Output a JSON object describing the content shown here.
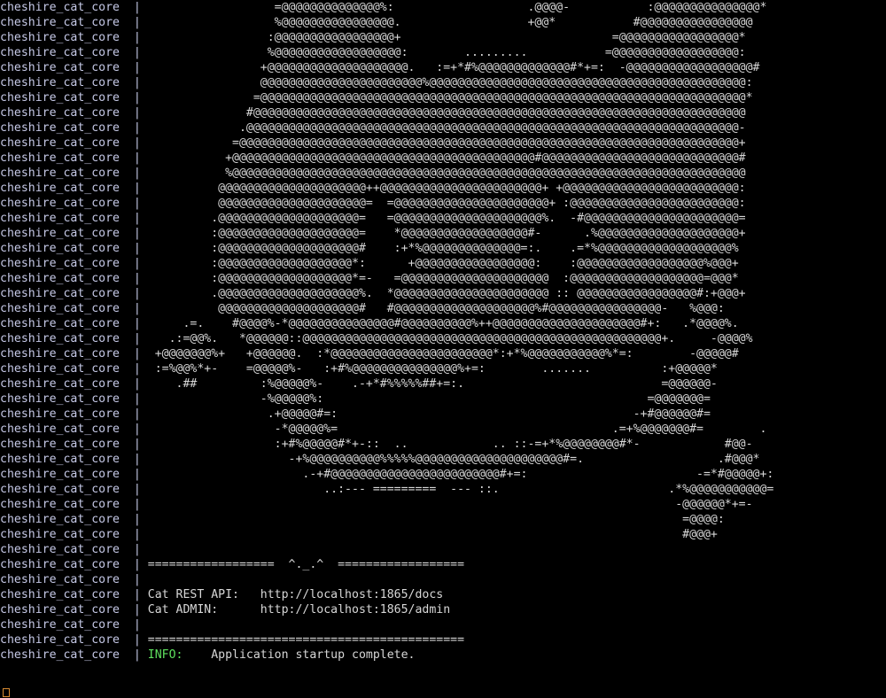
{
  "terminal": {
    "service_name": "cheshire_cat_core",
    "separator": "|",
    "background_color": "#000000",
    "service_color": "#c5c8e6",
    "art_color": "#d7d7d7",
    "info_color": "#5ee05e",
    "cursor_color": "#d98b32"
  },
  "banner": {
    "divider_top": "==================  ^._.^  ==================",
    "cat_face": "^._.^",
    "divider_bottom": "=============================================",
    "rest_api_label": "Cat REST API:",
    "rest_api_url": "http://localhost:1865/docs",
    "admin_label": "Cat ADMIN:",
    "admin_url": "http://localhost:1865/admin",
    "log_level": "INFO:",
    "status_message": "Application startup complete."
  },
  "ascii_art": {
    "description": "cheshire cat face rendered in ascii density characters",
    "charset": "@%#*+=:-. ",
    "lines": [
      "                   =@@@@@@@@@@@@@@%:                   .@@@@-           :@@@@@@@@@@@@@@@*",
      "                   %@@@@@@@@@@@@@@@@.                  +@@*           #@@@@@@@@@@@@@@@@",
      "                  :@@@@@@@@@@@@@@@@@+                              =@@@@@@@@@@@@@@@@@*",
      "                  %@@@@@@@@@@@@@@@@@@:        .........           =@@@@@@@@@@@@@@@@@@:",
      "                 +@@@@@@@@@@@@@@@@@@@@.   :=+*#%@@@@@@@@@@@@@#*+=:  -@@@@@@@@@@@@@@@@@@#",
      "                 @@@@@@@@@@@@@@@@@@@@@@@%@@@@@@@@@@@@@@@@@@@@@@@@@@@@@@@@@@@@@@@@@@@@@:",
      "                =@@@@@@@@@@@@@@@@@@@@@@@@@@@@@@@@@@@@@@@@@@@@@@@@@@@@@@@@@@@@@@@@@@@@@*",
      "               #@@@@@@@@@@@@@@@@@@@@@@@@@@@@@@@@@@@@@@@@@@@@@@@@@@@@@@@@@@@@@@@@@@@@@@",
      "              .@@@@@@@@@@@@@@@@@@@@@@@@@@@@@@@@@@@@@@@@@@@@@@@@@@@@@@@@@@@@@@@@@@@@@@-",
      "             =@@@@@@@@@@@@@@@@@@@@@@@@@@@@@@@@@@@@@@@@@@@@@@@@@@@@@@@@@@@@@@@@@@@@@@@+",
      "            +@@@@@@@@@@@@@@@@@@@@@@@@@@@@@@@@@@@@@@@@@@@#@@@@@@@@@@@@@@@@@@@@@@@@@@@@#",
      "            %@@@@@@@@@@@@@@@@@@@@@@@@@@@@@@@@@@@@@@@@@@@@@@@@@@@@@@@@@@@@@@@@@@@@@@@@@",
      "           @@@@@@@@@@@@@@@@@@@@@++@@@@@@@@@@@@@@@@@@@@@@@+ +@@@@@@@@@@@@@@@@@@@@@@@@@:",
      "           @@@@@@@@@@@@@@@@@@@@@=  =@@@@@@@@@@@@@@@@@@@@@@+ :@@@@@@@@@@@@@@@@@@@@@@@@:",
      "          .@@@@@@@@@@@@@@@@@@@@=   =@@@@@@@@@@@@@@@@@@@@@%.  -#@@@@@@@@@@@@@@@@@@@@@@=",
      "          :@@@@@@@@@@@@@@@@@@@@=    *@@@@@@@@@@@@@@@@@@#-      .%@@@@@@@@@@@@@@@@@@@@+",
      "          :@@@@@@@@@@@@@@@@@@@@#    :+*%@@@@@@@@@@@@@@=:.    .=*%@@@@@@@@@@@@@@@@@@@%",
      "          :@@@@@@@@@@@@@@@@@@@*:      +@@@@@@@@@@@@@@@@@:    :@@@@@@@@@@@@@@@@@@%@@@+",
      "          :@@@@@@@@@@@@@@@@@@@*=-   =@@@@@@@@@@@@@@@@@@@@@  :@@@@@@@@@@@@@@@@@@@=@@@*",
      "          .@@@@@@@@@@@@@@@@@@@@%.  *@@@@@@@@@@@@@@@@@@@@@@ :: @@@@@@@@@@@@@@@@@#:+@@@+",
      "           @@@@@@@@@@@@@@@@@@@@#   #@@@@@@@@@@@@@@@@@@@@%#@@@@@@@@@@@@@@@@-   %@@@:",
      "      .=.    #@@@@%-*@@@@@@@@@@@@@@@#@@@@@@@@@@%++@@@@@@@@@@@@@@@@@@@@@#+:   .*@@@@%.",
      "    .:=@@%.   *@@@@@@::@@@@@@@@@@@@@@@@@@@@@@@@@@@@@@@@@@@@@@@@@@@@@@@@@@@+.     -@@@@%",
      "  +@@@@@@@%+   +@@@@@@.  :*@@@@@@@@@@@@@@@@@@@@@@@*:+*%@@@@@@@@@@@%*=:        -@@@@@#",
      "  :=%@@%*+-    =@@@@@%-   :+#%@@@@@@@@@@@@@@@%+=:        .......          :+@@@@@*",
      "     .##         :%@@@@@%-    .-+*#%%%%%##+=:.                            =@@@@@@-",
      "                 -%@@@@@%:                                              =@@@@@@@=",
      "                  .+@@@@@#=:                                          -+#@@@@@@#=",
      "                   -*@@@@@%=                                       .=+%@@@@@@@#=        .",
      "                   :+#%@@@@@#*+-::  ..            .. ::-=+*%@@@@@@@@#*-            #@@-",
      "                     -+%@@@@@@@@@@%%%%%@@@@@@@@@@@@@@@@@@@@@#=.                   .#@@@*",
      "                       .-+#@@@@@@@@@@@@@@@@@@@@@@@@#+=:                        -=*#@@@@@+:",
      "                          ..:--- =========  --- ::.                        .*%@@@@@@@@@@@=",
      "                                                                            -@@@@@@*+=-",
      "                                                                             =@@@@:",
      "                                                                             #@@@+"
    ]
  }
}
